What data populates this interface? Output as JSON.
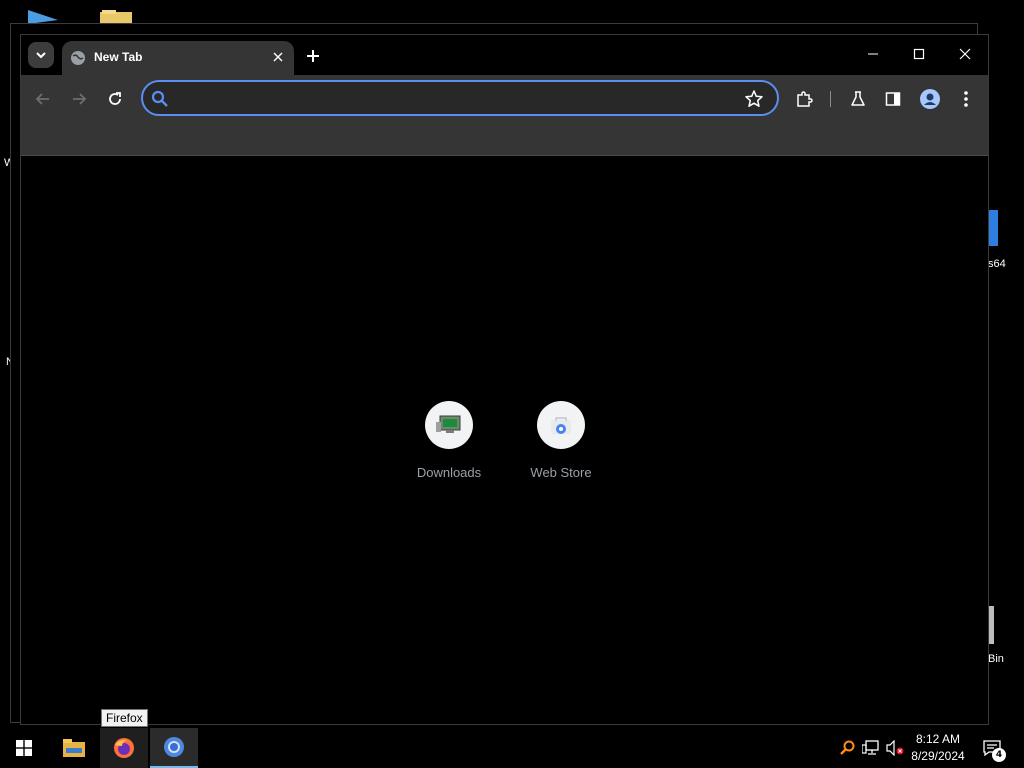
{
  "browser": {
    "tab": {
      "title": "New Tab"
    },
    "omnibox": {
      "value": "",
      "placeholder": ""
    }
  },
  "shortcuts": [
    {
      "label": "Downloads",
      "icon": "downloads-shortcut-icon"
    },
    {
      "label": "Web Store",
      "icon": "web-store-icon"
    }
  ],
  "desktop": {
    "labels": [
      "s64",
      "Bin",
      "W",
      "N"
    ]
  },
  "taskbar": {
    "tooltip": "Firefox",
    "clock_time": "8:12 AM",
    "clock_date": "8/29/2024",
    "notification_count": "4"
  },
  "colors": {
    "omnibox_focus": "#5b8ef0",
    "toolbar": "#353535",
    "taskbar_active_underline": "#76b9ed"
  }
}
